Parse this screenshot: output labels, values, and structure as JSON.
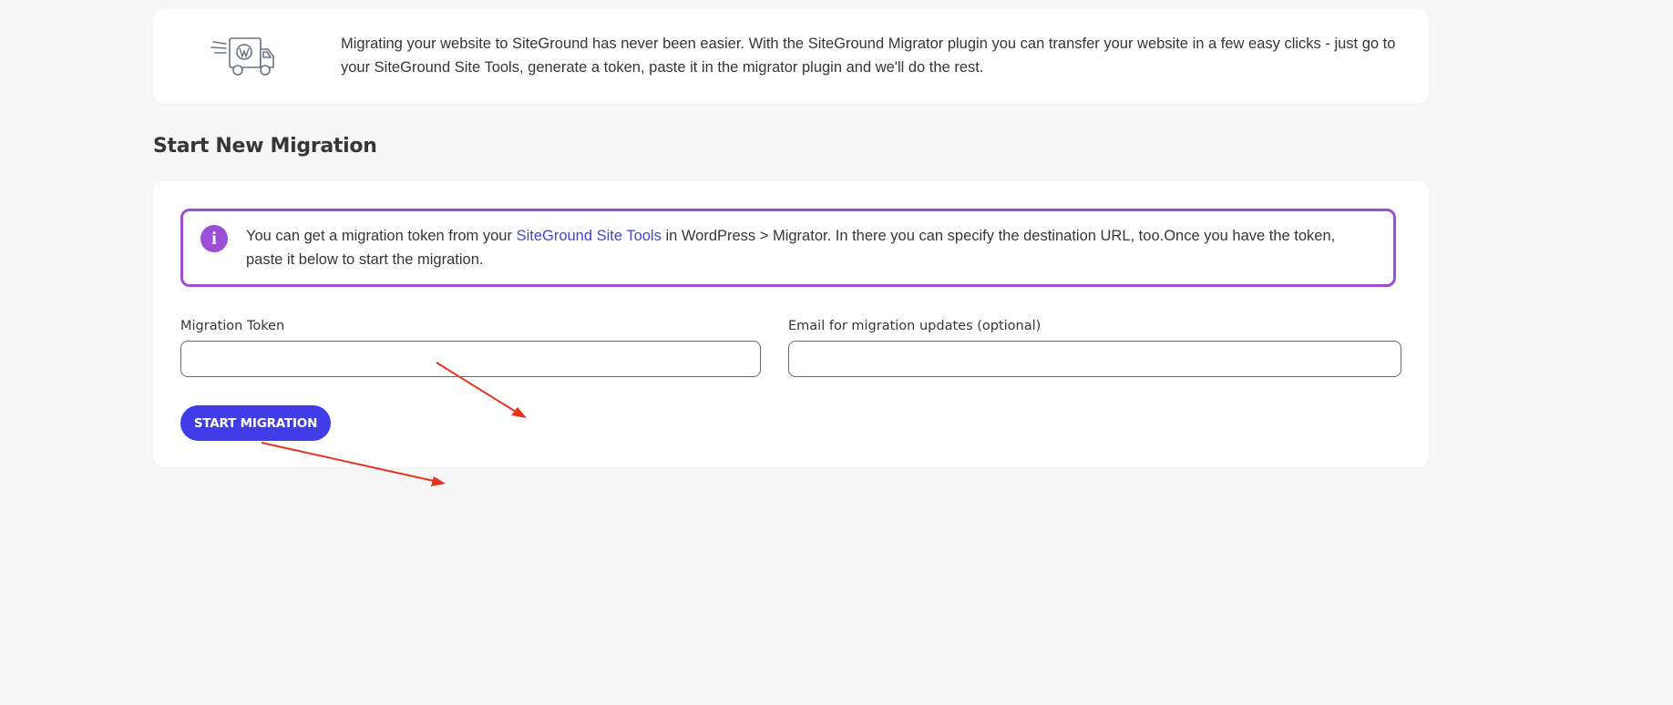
{
  "intro": {
    "icon": "migration-truck-icon",
    "text": "Migrating your website to SiteGround has never been easier. With the SiteGround Migrator plugin you can transfer your website in a few easy clicks - just go to your SiteGround Site Tools, generate a token, paste it in the migrator plugin and we'll do the rest."
  },
  "section": {
    "title": "Start New Migration"
  },
  "notice": {
    "icon": "info-icon",
    "text_before": "You can get a migration token from your ",
    "link_label": "SiteGround Site Tools",
    "text_after": " in WordPress > Migrator. In there you can specify the destination URL, too.Once you have the token, paste it below to start the migration."
  },
  "form": {
    "token_label": "Migration Token",
    "token_value": "",
    "email_label": "Email for migration updates (optional)",
    "email_value": "",
    "submit_label": "START MIGRATION"
  },
  "colors": {
    "accent": "#3f3ce8",
    "link": "#3f46d8",
    "notice_border": "#9b4fd6",
    "annotation_arrow": "#e8321e"
  }
}
